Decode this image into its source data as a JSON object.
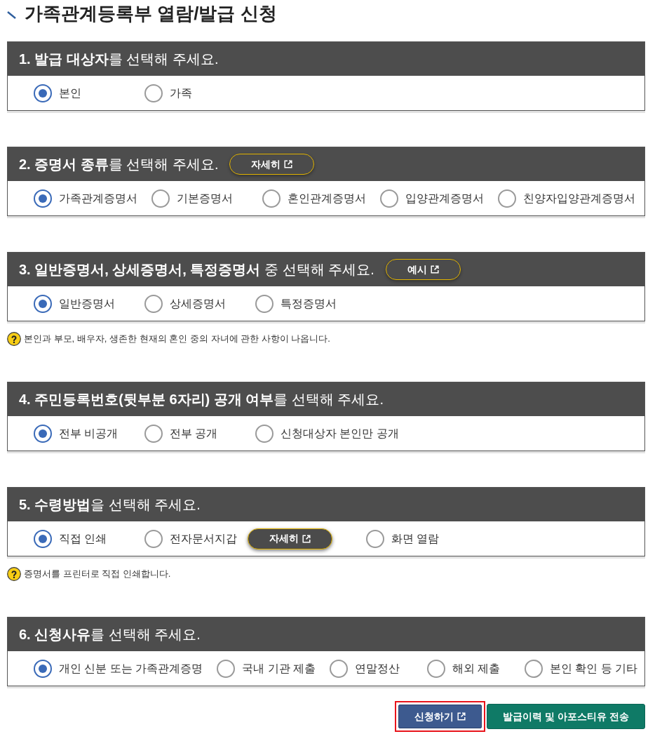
{
  "page_title": "가족관계등록부 열람/발급 신청",
  "sections": [
    {
      "heading": "**1. 발급 대상자**를 선택해 주세요.",
      "options": [
        {
          "kind": "radio",
          "label": "본인",
          "selected": true
        },
        {
          "kind": "radio",
          "label": "가족",
          "selected": false
        }
      ]
    },
    {
      "heading": "**2. 증명서 종류**를 선택해 주세요.",
      "details_button": {
        "label": "자세히"
      },
      "options": [
        {
          "kind": "radio",
          "label": "가족관계증명서",
          "selected": true
        },
        {
          "kind": "radio",
          "label": "기본증명서",
          "selected": false
        },
        {
          "kind": "radio",
          "label": "혼인관계증명서",
          "selected": false
        },
        {
          "kind": "radio",
          "label": "입양관계증명서",
          "selected": false
        },
        {
          "kind": "radio",
          "label": "친양자입양관계증명서",
          "selected": false
        }
      ]
    },
    {
      "heading": "**3. 일반증명서, 상세증명서, 특정증명서** 중 선택해 주세요.",
      "details_button": {
        "label": "예시"
      },
      "options": [
        {
          "kind": "radio",
          "label": "일반증명서",
          "selected": true
        },
        {
          "kind": "radio",
          "label": "상세증명서",
          "selected": false
        },
        {
          "kind": "radio",
          "label": "특정증명서",
          "selected": false
        }
      ],
      "hint": "본인과 부모, 배우자, 생존한 현재의 혼인 중의 자녀에 관한 사항이 나옵니다."
    },
    {
      "heading": "**4. 주민등록번호(뒷부분 6자리) 공개 여부**를 선택해 주세요.",
      "options": [
        {
          "kind": "radio",
          "label": "전부 비공개",
          "selected": true
        },
        {
          "kind": "radio",
          "label": "전부 공개",
          "selected": false
        },
        {
          "kind": "radio",
          "label": "신청대상자 본인만 공개",
          "selected": false
        }
      ]
    },
    {
      "heading": "**5. 수령방법**을 선택해 주세요.",
      "options": [
        {
          "kind": "radio",
          "label": "직접 인쇄",
          "selected": true
        },
        {
          "kind": "radio",
          "label": "전자문서지갑",
          "selected": false,
          "details_button": {
            "label": "자세히"
          }
        },
        {
          "kind": "radio",
          "label": "화면 열람",
          "selected": false
        }
      ],
      "hint": "증명서를 프린터로 직접 인쇄합니다."
    },
    {
      "heading": "**6. 신청사유**를 선택해 주세요.",
      "options": [
        {
          "kind": "radio",
          "label": "개인 신분 또는 가족관계증명",
          "selected": true
        },
        {
          "kind": "radio",
          "label": "국내 기관 제출",
          "selected": false
        },
        {
          "kind": "radio",
          "label": "연말정산",
          "selected": false
        },
        {
          "kind": "radio",
          "label": "해외 제출",
          "selected": false
        },
        {
          "kind": "radio",
          "label": "본인 확인 등 기타",
          "selected": false
        }
      ]
    }
  ],
  "actions": [
    {
      "kind": "primary",
      "label": "신청하기",
      "external": true,
      "highlighted": true
    },
    {
      "kind": "secondary",
      "label": "발급이력 및 아포스티유 전송",
      "external": false,
      "highlighted": false
    }
  ]
}
